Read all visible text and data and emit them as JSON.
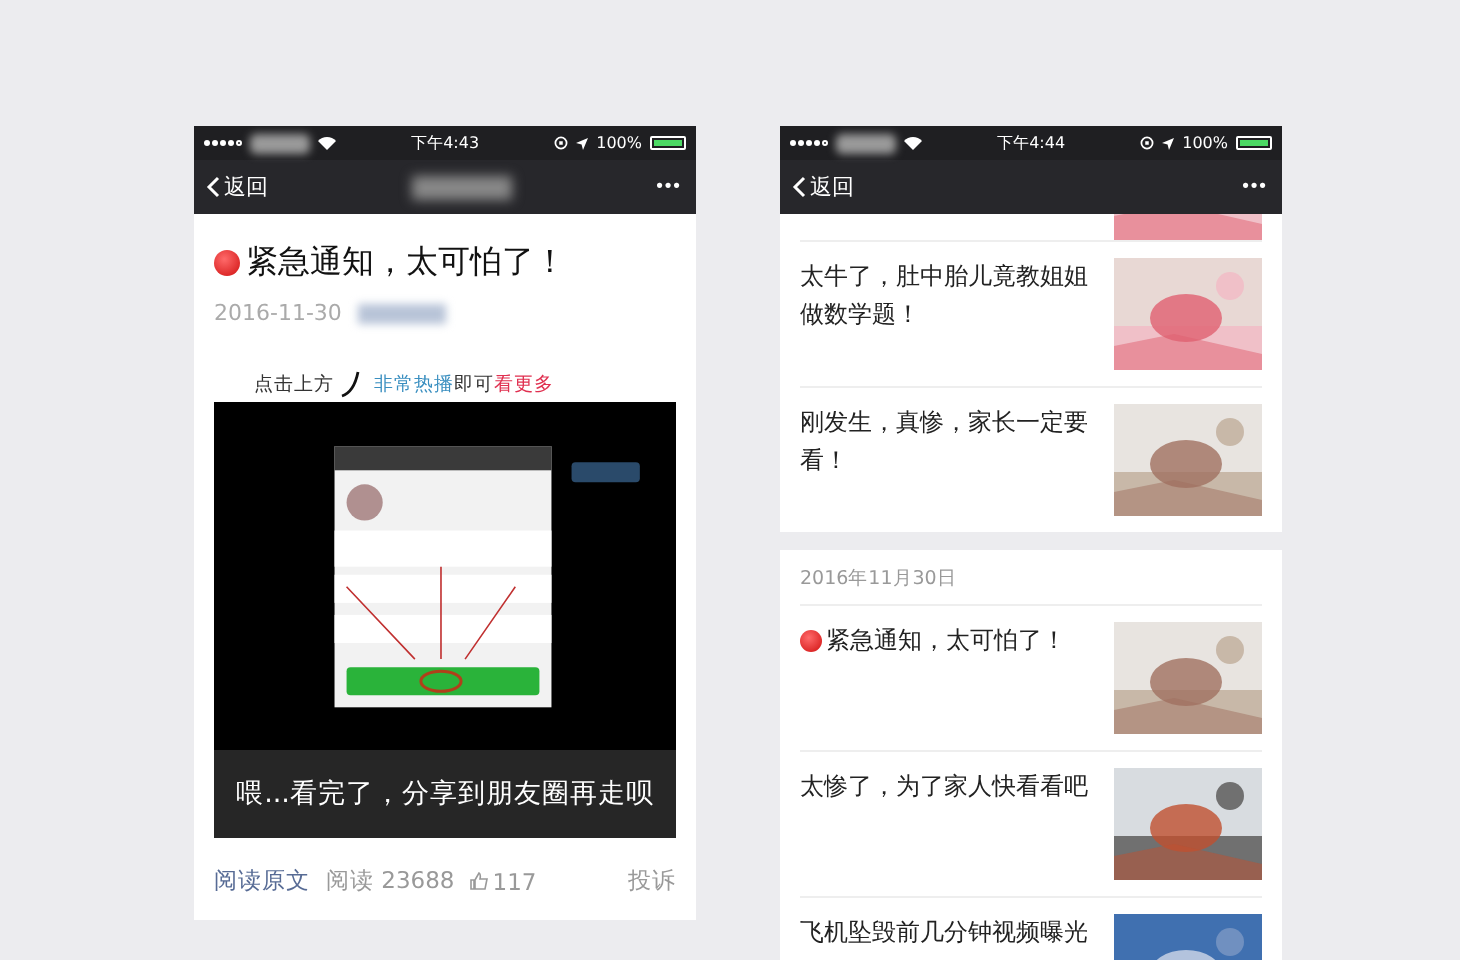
{
  "phones": [
    {
      "status_bar": {
        "time": "下午4:43",
        "battery": "100%"
      },
      "nav": {
        "back": "返回",
        "more": "•••"
      },
      "article": {
        "title": "紧急通知，太可怕了！",
        "date": "2016-11-30",
        "prompt": {
          "lead": "点击上方",
          "highlight": "非常热播",
          "middle": "即可",
          "emphasis": "看更多"
        },
        "video": {
          "kind": "picture",
          "caption": "喂...看完了，分享到朋友圈再走呗"
        },
        "footer": {
          "read_original": "阅读原文",
          "reads": "阅读 23688",
          "likes": "117",
          "report": "投诉"
        }
      }
    },
    {
      "status_bar": {
        "time": "下午4:44",
        "battery": "100%"
      },
      "nav": {
        "back": "返回",
        "more": "•••"
      },
      "groups": [
        {
          "items": [
            {
              "title": "太牛了，肚中胎儿竟教姐姐做数学题！",
              "urgent": false
            },
            {
              "title": "刚发生，真惨，家长一定要看！",
              "urgent": false
            }
          ]
        },
        {
          "date": "2016年11月30日",
          "items": [
            {
              "title": "紧急通知，太可怕了！",
              "urgent": true
            },
            {
              "title": "太惨了，为了家人快看看吧",
              "urgent": false
            },
            {
              "title": "飞机坠毁前几分钟视频曝光",
              "urgent": false
            }
          ]
        }
      ]
    }
  ]
}
